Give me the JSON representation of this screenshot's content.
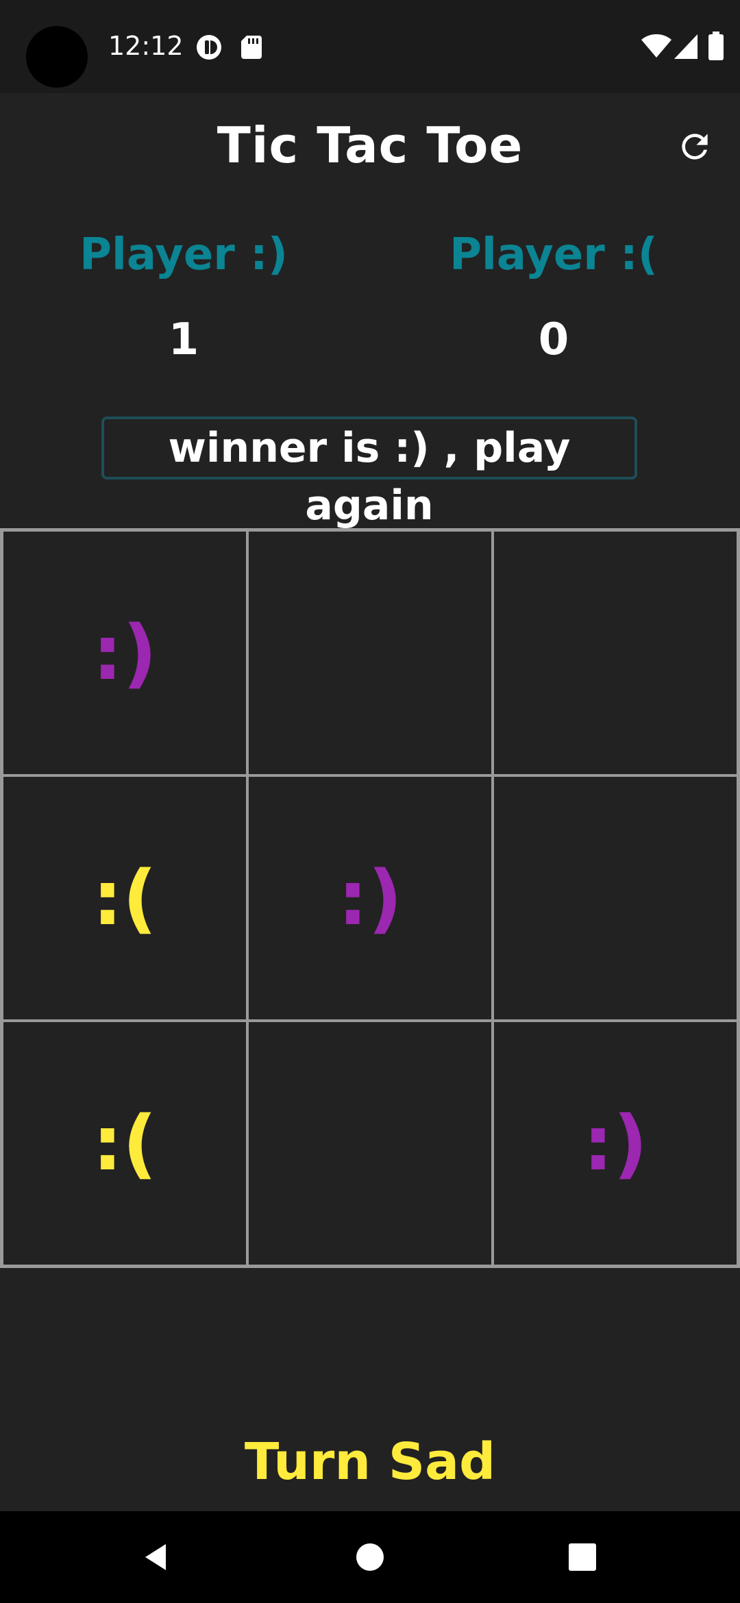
{
  "status_bar": {
    "time": "12:12",
    "icons": [
      "notification-app-icon",
      "sd-card-icon",
      "wifi-icon",
      "cell-signal-icon",
      "battery-icon"
    ]
  },
  "toolbar": {
    "title": "Tic  Tac  Toe",
    "refresh_icon": "refresh-icon"
  },
  "scoreboard": {
    "player_happy": {
      "label": "Player :)",
      "score": "1"
    },
    "player_sad": {
      "label": "Player :(",
      "score": "0"
    }
  },
  "message": "winner is :) , play again",
  "board": {
    "cells": [
      {
        "value": ":)",
        "type": "happy"
      },
      {
        "value": "",
        "type": "empty"
      },
      {
        "value": "",
        "type": "empty"
      },
      {
        "value": ":(",
        "type": "sad"
      },
      {
        "value": ":)",
        "type": "happy"
      },
      {
        "value": "",
        "type": "empty"
      },
      {
        "value": ":(",
        "type": "sad"
      },
      {
        "value": "",
        "type": "empty"
      },
      {
        "value": ":)",
        "type": "happy"
      }
    ]
  },
  "turn": "Turn Sad",
  "nav": {
    "back_icon": "back-triangle-icon",
    "home_icon": "home-circle-icon",
    "recents_icon": "recents-square-icon"
  },
  "colors": {
    "background": "#222222",
    "player_label": "#0b8493",
    "happy": "#9c27b0",
    "sad": "#ffeb3b"
  }
}
